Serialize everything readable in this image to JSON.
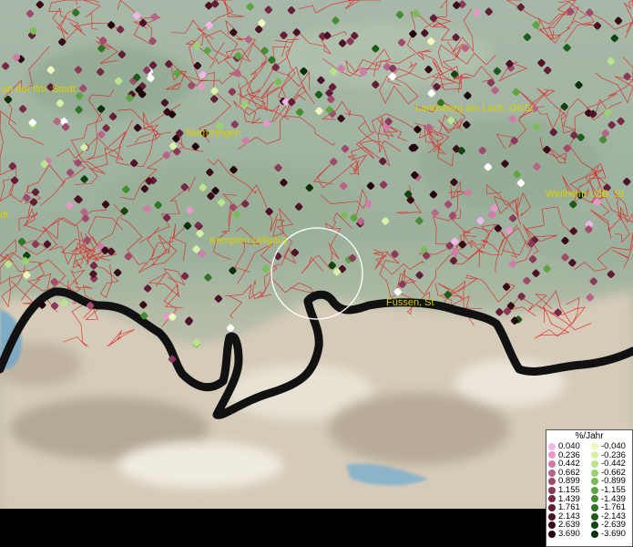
{
  "map": {
    "cities": [
      {
        "name": "an der Ilm, Stadt"
      },
      {
        "name": "Memmingen"
      },
      {
        "name": "Landsberg am Lech, GKSt"
      },
      {
        "name": "Weilheim i.OB, St"
      },
      {
        "name": "dt"
      },
      {
        "name": "Kempten (Allgäu)"
      },
      {
        "name": "Füssen, St"
      }
    ]
  },
  "legend": {
    "title": "%/Jahr",
    "positive": [
      {
        "value": "0.040",
        "color": "#f0b8e8"
      },
      {
        "value": "0.236",
        "color": "#e49ac8"
      },
      {
        "value": "0.442",
        "color": "#d07ca8"
      },
      {
        "value": "0.662",
        "color": "#b86488"
      },
      {
        "value": "0.899",
        "color": "#a04a6c"
      },
      {
        "value": "1.155",
        "color": "#8c3858"
      },
      {
        "value": "1.439",
        "color": "#762a46"
      },
      {
        "value": "1.761",
        "color": "#621e36"
      },
      {
        "value": "2.143",
        "color": "#4c1226"
      },
      {
        "value": "2.639",
        "color": "#380a18"
      },
      {
        "value": "3.690",
        "color": "#22040c"
      }
    ],
    "negative": [
      {
        "value": "-0.040",
        "color": "#f0f8c0"
      },
      {
        "value": "-0.236",
        "color": "#d8f0a8"
      },
      {
        "value": "-0.442",
        "color": "#bce48c"
      },
      {
        "value": "-0.662",
        "color": "#9ad270"
      },
      {
        "value": "-0.899",
        "color": "#7cbc58"
      },
      {
        "value": "-1.155",
        "color": "#5ea444"
      },
      {
        "value": "-1.439",
        "color": "#468c34"
      },
      {
        "value": "-1.761",
        "color": "#307426"
      },
      {
        "value": "-2.143",
        "color": "#1e5c1a"
      },
      {
        "value": "-2.639",
        "color": "#104410"
      },
      {
        "value": "-3.690",
        "color": "#063008"
      }
    ]
  }
}
